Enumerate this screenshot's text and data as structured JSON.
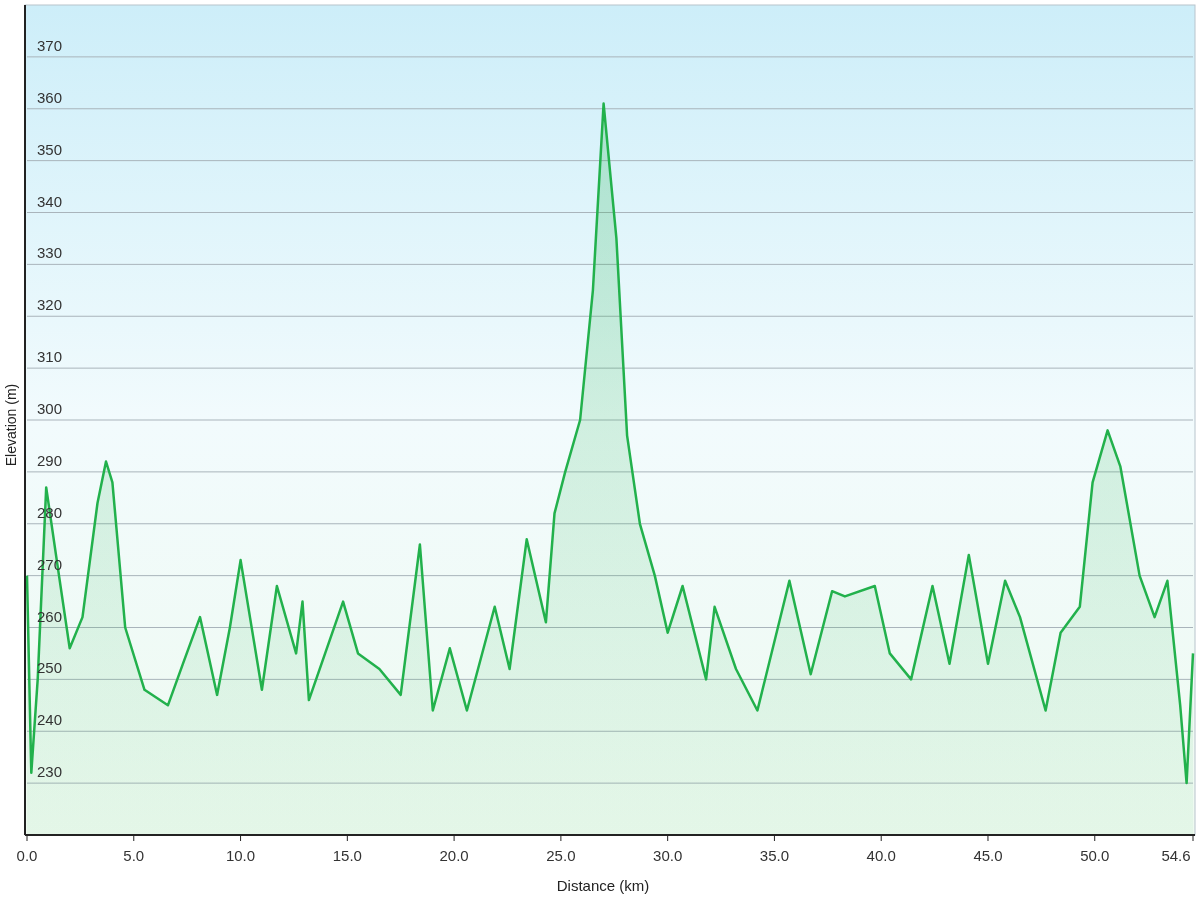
{
  "chart_data": {
    "type": "area",
    "grid": true,
    "xlabel": "Distance (km)",
    "ylabel": "Elevation (m)",
    "xlim": [
      0,
      54.6
    ],
    "ylim": [
      220,
      380
    ],
    "xticks": [
      {
        "value": 0,
        "label": "0.0"
      },
      {
        "value": 5,
        "label": "5.0"
      },
      {
        "value": 10,
        "label": "10.0"
      },
      {
        "value": 15,
        "label": "15.0"
      },
      {
        "value": 20,
        "label": "20.0"
      },
      {
        "value": 25,
        "label": "25.0"
      },
      {
        "value": 30,
        "label": "30.0"
      },
      {
        "value": 35,
        "label": "35.0"
      },
      {
        "value": 40,
        "label": "40.0"
      },
      {
        "value": 45,
        "label": "45.0"
      },
      {
        "value": 50,
        "label": "50.0"
      },
      {
        "value": 54.6,
        "label": "54.6"
      }
    ],
    "yticks": [
      230,
      240,
      250,
      260,
      270,
      280,
      290,
      300,
      310,
      320,
      330,
      340,
      350,
      360,
      370
    ],
    "x": [
      0,
      0.2,
      0.5,
      0.9,
      1.5,
      2.0,
      2.6,
      3.3,
      3.7,
      4.0,
      4.6,
      5.5,
      6.6,
      7.3,
      8.1,
      8.9,
      9.5,
      10.0,
      11.0,
      11.7,
      12.6,
      12.9,
      13.2,
      14.8,
      15.5,
      16.5,
      17.5,
      18.4,
      19.0,
      19.8,
      20.6,
      21.9,
      22.6,
      23.4,
      24.3,
      24.7,
      25.2,
      25.9,
      26.5,
      27.0,
      27.6,
      28.1,
      28.7,
      29.4,
      30.0,
      30.7,
      31.8,
      32.2,
      33.2,
      34.2,
      35.7,
      36.7,
      37.7,
      38.3,
      39.7,
      40.4,
      41.4,
      42.4,
      43.2,
      44.1,
      45.0,
      45.8,
      46.5,
      47.7,
      48.4,
      49.3,
      49.9,
      50.6,
      51.2,
      52.1,
      52.8,
      53.4,
      54.0,
      54.3,
      54.6
    ],
    "series": [
      {
        "color": "#22b14c",
        "values": [
          270,
          232,
          250,
          287,
          270,
          256,
          262,
          284,
          292,
          288,
          260,
          248,
          245,
          253,
          262,
          247,
          260,
          273,
          248,
          268,
          255,
          265,
          246,
          265,
          255,
          252,
          247,
          276,
          244,
          256,
          244,
          264,
          252,
          277,
          261,
          282,
          290,
          300,
          325,
          361,
          335,
          297,
          280,
          270,
          259,
          268,
          250,
          264,
          252,
          244,
          269,
          251,
          267,
          266,
          268,
          255,
          250,
          268,
          253,
          274,
          253,
          269,
          262,
          244,
          259,
          264,
          288,
          298,
          291,
          270,
          262,
          269,
          245,
          230,
          255
        ]
      }
    ]
  }
}
